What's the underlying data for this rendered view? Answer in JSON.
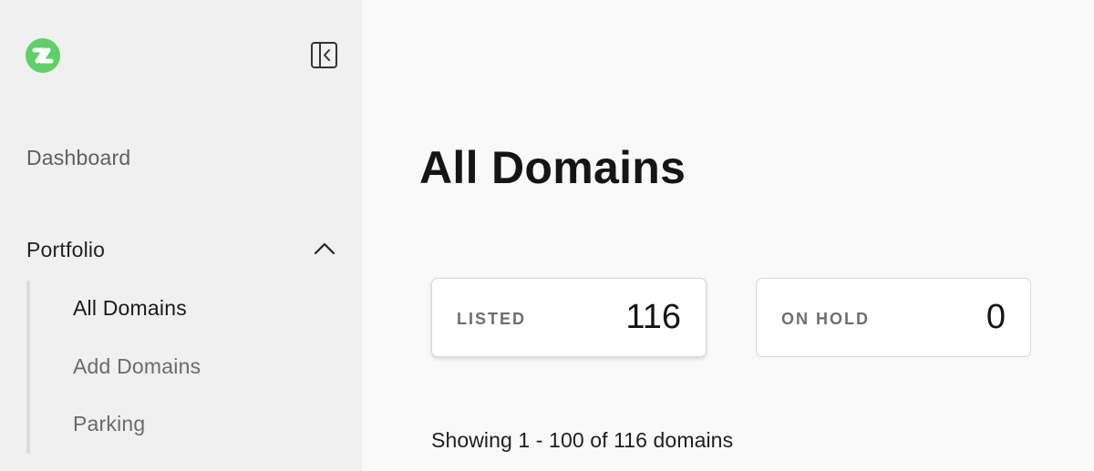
{
  "sidebar": {
    "nav": {
      "dashboard": "Dashboard",
      "portfolio": "Portfolio"
    },
    "portfolio_items": [
      {
        "label": "All Domains",
        "active": true
      },
      {
        "label": "Add Domains",
        "active": false
      },
      {
        "label": "Parking",
        "active": false
      }
    ],
    "logo_color": "#5fd068"
  },
  "main": {
    "title": "All Domains",
    "stats": [
      {
        "label": "LISTED",
        "value": "116"
      },
      {
        "label": "ON HOLD",
        "value": "0"
      }
    ],
    "showing": "Showing 1 - 100 of 116 domains"
  }
}
